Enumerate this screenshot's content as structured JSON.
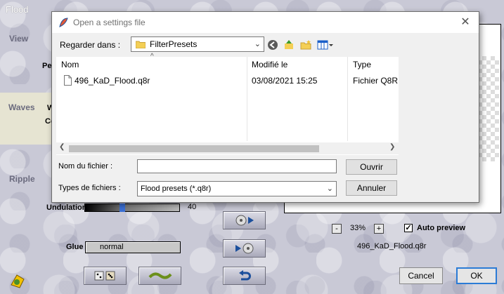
{
  "app": {
    "title": "Flood",
    "sections": {
      "view": "View",
      "waves": "Waves",
      "ripple": "Ripple"
    },
    "partial_labels": {
      "per": "Per",
      "w": "W",
      "co": "Co"
    },
    "undulation": {
      "label": "Undulation",
      "value": "40",
      "level": 0.4
    },
    "glue": {
      "label": "Glue",
      "value": "normal"
    },
    "zoom": {
      "minus": "-",
      "value": "33%",
      "plus": "+"
    },
    "auto_preview": {
      "label": "Auto preview",
      "checked": true
    },
    "preset_name": "496_KaD_Flood.q8r",
    "buttons": {
      "cancel": "Cancel",
      "ok": "OK"
    }
  },
  "dialog": {
    "title": "Open a settings file",
    "look_in_label": "Regarder dans :",
    "look_in_value": "FilterPresets",
    "columns": [
      "Nom",
      "Modifié le",
      "Type"
    ],
    "files": [
      {
        "name": "496_KaD_Flood.q8r",
        "modified": "03/08/2021 15:25",
        "type": "Fichier Q8R"
      }
    ],
    "filename_label": "Nom du fichier :",
    "filename_value": "",
    "filetype_label": "Types de fichiers :",
    "filetype_value": "Flood presets (*.q8r)",
    "open_button": "Ouvrir",
    "cancel_button": "Annuler",
    "close_glyph": "✕",
    "sort_glyph": "^"
  }
}
